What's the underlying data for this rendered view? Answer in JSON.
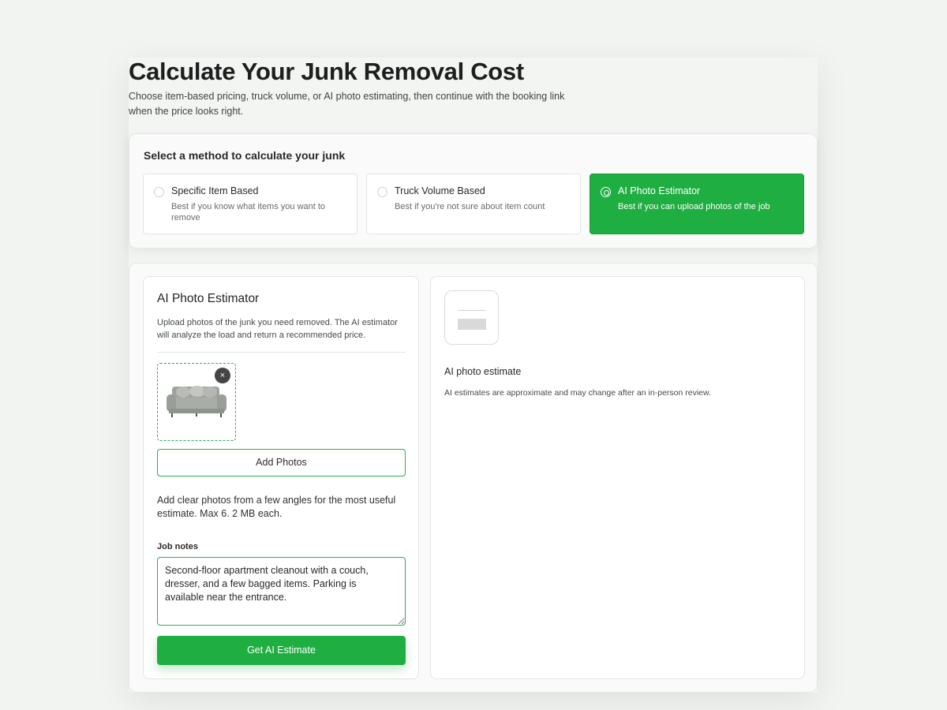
{
  "header": {
    "title": "Calculate Your Junk Removal Cost",
    "subtitle": "Choose item-based pricing, truck volume, or AI photo estimating, then continue with the booking link when the price looks right."
  },
  "methods": {
    "heading": "Select a method to calculate your junk",
    "options": [
      {
        "label": "Specific Item Based",
        "desc": "Best if you know what items you want to remove",
        "selected": false
      },
      {
        "label": "Truck Volume Based",
        "desc": "Best if you're not sure about item count",
        "selected": false
      },
      {
        "label": "AI Photo Estimator",
        "desc": "Best if you can upload photos of the job",
        "selected": true
      }
    ]
  },
  "estimator": {
    "title": "AI Photo Estimator",
    "description": "Upload photos of the junk you need removed. The AI estimator will analyze the load and return a recommended price.",
    "remove_label": "×",
    "add_photos_label": "Add Photos",
    "hint": "Add clear photos from a few angles for the most useful estimate. Max 6. 2 MB each.",
    "notes_label": "Job notes",
    "notes_value": "Second-floor apartment cleanout with a couch, dresser, and a few bagged items. Parking is available near the entrance.",
    "submit_label": "Get AI Estimate"
  },
  "result": {
    "title": "AI photo estimate",
    "note": "AI estimates are approximate and may change after an in-person review."
  },
  "colors": {
    "accent": "#1fae41",
    "background": "#f1f4f1"
  }
}
